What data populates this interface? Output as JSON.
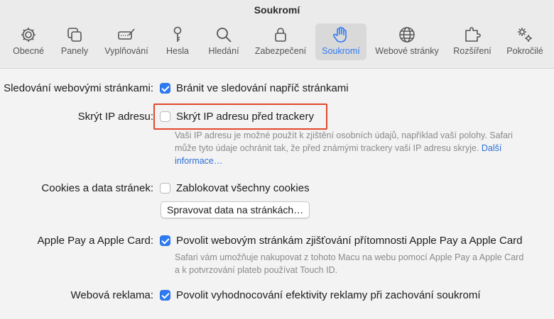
{
  "window": {
    "title": "Soukromí"
  },
  "tabs": [
    {
      "label": "Obecné",
      "icon": "gear-icon"
    },
    {
      "label": "Panely",
      "icon": "tabs-icon"
    },
    {
      "label": "Vyplňování",
      "icon": "autofill-icon"
    },
    {
      "label": "Hesla",
      "icon": "key-icon"
    },
    {
      "label": "Hledání",
      "icon": "search-icon"
    },
    {
      "label": "Zabezpečení",
      "icon": "lock-icon"
    },
    {
      "label": "Soukromí",
      "icon": "hand-icon",
      "active": true
    },
    {
      "label": "Webové stránky",
      "icon": "globe-icon"
    },
    {
      "label": "Rozšíření",
      "icon": "puzzle-icon"
    },
    {
      "label": "Pokročilé",
      "icon": "gears-icon"
    }
  ],
  "settings": {
    "tracking": {
      "label": "Sledování webovými stránkami:",
      "option": "Bránit ve sledování napříč stránkami",
      "checked": true
    },
    "hide_ip": {
      "label": "Skrýt IP adresu:",
      "option": "Skrýt IP adresu před trackery",
      "checked": false,
      "desc_line1": "Vaši IP adresu je možné použít k zjištění osobních údajů, například vaší polohy. Safari",
      "desc_line2": "může tyto údaje ochránit tak, že před známými trackery vaši IP adresu skryje.",
      "link_part1": "Další",
      "link_part2": "informace…"
    },
    "cookies": {
      "label": "Cookies a data stránek:",
      "option": "Zablokovat všechny cookies",
      "checked": false,
      "button": "Spravovat data na stránkách…"
    },
    "apple_pay": {
      "label": "Apple Pay a Apple Card:",
      "option": "Povolit webovým stránkám zjišťování přítomnosti Apple Pay a Apple Card",
      "checked": true,
      "desc_line1": "Safari vám umožňuje nakupovat z tohoto Macu na webu pomocí Apple Pay a Apple Card",
      "desc_line2": "a k potvrzování plateb používat Touch ID."
    },
    "ads": {
      "label": "Webová reklama:",
      "option": "Povolit vyhodnocování efektivity reklamy při zachování soukromí",
      "checked": true
    }
  },
  "colors": {
    "accent": "#2d7bf4",
    "highlight": "#e2472c"
  }
}
